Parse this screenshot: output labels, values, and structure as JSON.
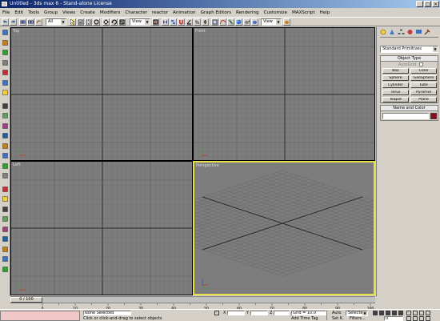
{
  "window": {
    "title": "Untitled - 3ds max 6 - Stand-alone License",
    "min_glyph": "_",
    "max_glyph": "□",
    "close_glyph": "×"
  },
  "menu": {
    "items": [
      "File",
      "Edit",
      "Tools",
      "Group",
      "Views",
      "Create",
      "Modifiers",
      "Character",
      "reactor",
      "Animation",
      "Graph Editors",
      "Rendering",
      "Customize",
      "MAXScript",
      "Help"
    ]
  },
  "toolbar": {
    "selection_filter": "All",
    "reference_coord": "View"
  },
  "viewports": {
    "top": {
      "label": "Top"
    },
    "front": {
      "label": "Front"
    },
    "left": {
      "label": "Left"
    },
    "perspective": {
      "label": "Perspective"
    }
  },
  "command_panel": {
    "category_dropdown": "Standard Primitives",
    "object_type_header": "Object Type",
    "autogrid_label": "AutoGrid",
    "primitives": [
      "Box",
      "Cone",
      "Sphere",
      "GeoSphere",
      "Cylinder",
      "Tube",
      "Torus",
      "Pyramid",
      "Teapot",
      "Plane"
    ],
    "name_color_header": "Name and Color",
    "object_color": "#8b0a1e"
  },
  "timeslider": {
    "frame_display": "0 / 100",
    "ticks": [
      "0",
      "10",
      "20",
      "30",
      "40",
      "50",
      "60",
      "70",
      "80",
      "90",
      "100"
    ]
  },
  "status": {
    "selection_text": "None Selected",
    "prompt_text": "Click or click-and-drag to select objects",
    "grid_text": "Grid = 10.0",
    "add_time_tag": "Add Time Tag",
    "auto_key_label": "Auto",
    "set_key_label": "Set K.",
    "key_filter_value": "Selected",
    "filters_label": "Filters...",
    "current_frame": "0",
    "x_label": "X",
    "y_label": "Y",
    "z_label": "Z"
  },
  "colors": {
    "title_start": "#0a246a",
    "title_end": "#a6caf0",
    "viewport_bg": "#7d7d7d",
    "active_border": "#e8e048",
    "grid_line": "#727272",
    "axis_line": "#2b2b2b",
    "status_error": "#f0c8c8"
  }
}
